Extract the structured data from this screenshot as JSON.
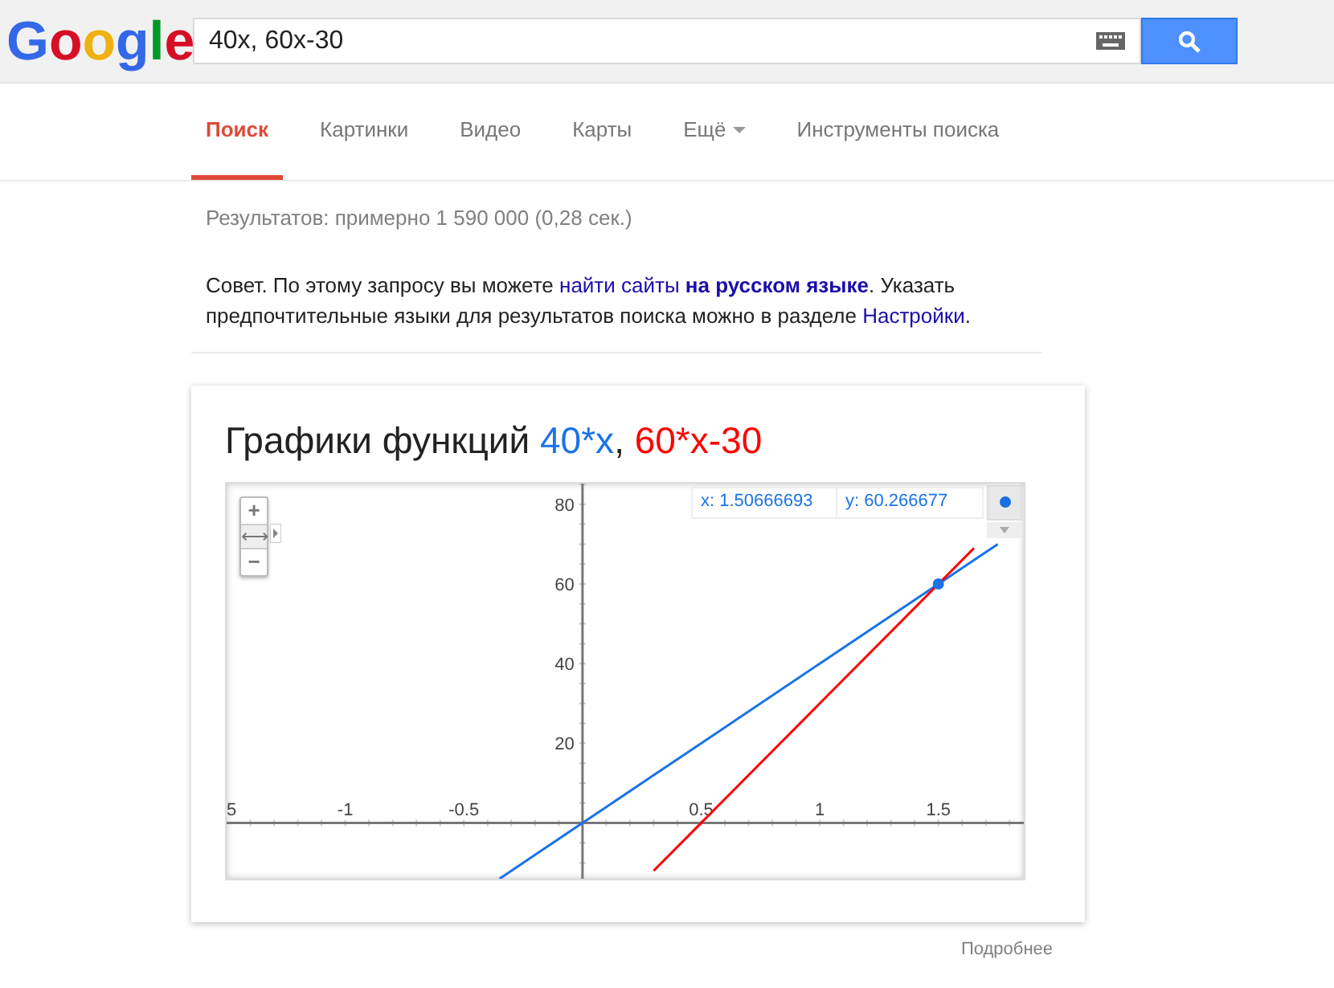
{
  "logo": {
    "letters": [
      {
        "char": "G",
        "color": "#3369e8"
      },
      {
        "char": "o",
        "color": "#d50f25"
      },
      {
        "char": "o",
        "color": "#eeb211"
      },
      {
        "char": "g",
        "color": "#3369e8"
      },
      {
        "char": "l",
        "color": "#009925"
      },
      {
        "char": "e",
        "color": "#d50f25"
      }
    ]
  },
  "search": {
    "value": "40x, 60x-30"
  },
  "tabs": [
    {
      "label": "Поиск",
      "selected": true,
      "dropdown": false
    },
    {
      "label": "Картинки",
      "selected": false,
      "dropdown": false
    },
    {
      "label": "Видео",
      "selected": false,
      "dropdown": false
    },
    {
      "label": "Карты",
      "selected": false,
      "dropdown": false
    },
    {
      "label": "Ещё",
      "selected": false,
      "dropdown": true
    },
    {
      "label": "Инструменты поиска",
      "selected": false,
      "dropdown": false
    }
  ],
  "result_stats": "Результатов: примерно 1 590 000 (0,28 сек.)",
  "tip": {
    "parts": [
      {
        "kind": "text",
        "text": "Совет. По этому запросу вы можете "
      },
      {
        "kind": "link",
        "text": "найти сайты **на русском языке**"
      },
      {
        "kind": "text",
        "text": ". Указать предпочтительные языки для результатов поиска можно в разделе "
      },
      {
        "kind": "link",
        "text": "Настройки"
      },
      {
        "kind": "text",
        "text": "."
      }
    ]
  },
  "graph_card": {
    "title_prefix": "Графики функций",
    "title_separator": ",",
    "readout": {
      "x": "x: 1.50666693",
      "y": "y: 60.266677"
    },
    "zoom_controls": {
      "plus": "+",
      "pan": "⟷",
      "minus": "−"
    },
    "chart_data": {
      "type": "line",
      "x": [
        -0.35,
        0,
        0.3,
        0.5,
        1,
        1.5,
        1.65,
        1.75
      ],
      "series": [
        {
          "name": "40*x",
          "color": "#1a73e8",
          "values": [
            -14,
            0,
            12,
            20,
            40,
            60,
            66,
            70
          ]
        },
        {
          "name": "60*x-30",
          "color": "#ff0000",
          "values": [
            null,
            null,
            -12,
            0,
            30,
            60,
            69,
            null
          ]
        }
      ],
      "xlim": [
        -1.5,
        1.86
      ],
      "ylim": [
        -14,
        85.2
      ],
      "xticks": [
        -1,
        -0.5,
        0.5,
        1,
        1.5
      ],
      "yticks": [
        20,
        40,
        60,
        80
      ]
    },
    "cut_x_label": "5"
  },
  "more_link": "Подробнее"
}
